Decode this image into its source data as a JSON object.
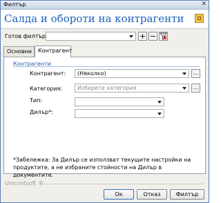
{
  "window": {
    "title": "Филтър",
    "close_glyph": "✕"
  },
  "header": {
    "title": "Салда и обороти на контрагенти",
    "logo_icon": "app-logo-icon"
  },
  "preset": {
    "label": "Готов филтър:",
    "value": "",
    "add": "+",
    "remove": "−"
  },
  "tabs": [
    {
      "label": "Основни"
    },
    {
      "label": "Контрагент"
    }
  ],
  "group": {
    "title": "Контрагенти"
  },
  "fields": {
    "kontragent": {
      "label": "Контрагент:",
      "value": "(Няколко)"
    },
    "category": {
      "label": "Категория:",
      "placeholder": "Изберете категория"
    },
    "type": {
      "label": "Тип:",
      "value": ""
    },
    "dealer": {
      "label": "Дилър*:",
      "value": ""
    }
  },
  "note": "*Забележка: За Дилър се използват текущите настройки на продуктите, а не избраните стойности на Дилър в документите.",
  "footer": {
    "brand": "Unicontsoft ®"
  },
  "buttons": {
    "ok": "Ок",
    "cancel": "Отказ",
    "filter": "Филтър"
  },
  "colors": {
    "accent": "#1d5fb8"
  }
}
